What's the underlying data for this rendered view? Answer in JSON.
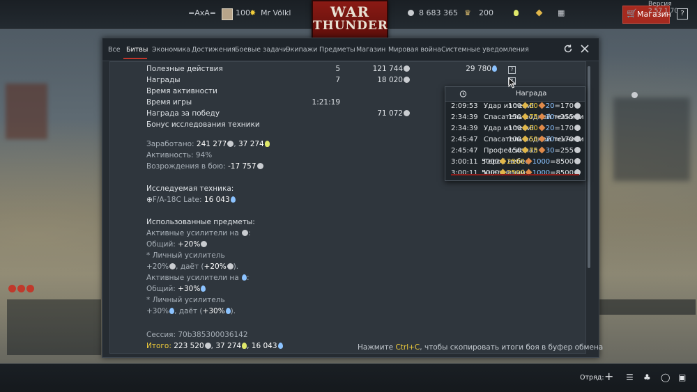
{
  "app": {
    "version": "Версия 2.57.1.70"
  },
  "topbar": {
    "squadron": "=AxA=",
    "level": "100",
    "player": "Mr Völkl",
    "logo_line1": "WAR",
    "logo_line2": "THUNDER",
    "silver_lions": "8 683 365",
    "golden_eagles": "200",
    "shop_label": "Магазин",
    "help_label": "?"
  },
  "tabs": [
    "Все",
    "Битвы",
    "Экономика",
    "Достижения",
    "Боевые задачи",
    "Экипажи",
    "Предметы",
    "Магазин",
    "Мировая война",
    "Системные уведомления"
  ],
  "report": {
    "rows": [
      {
        "label": "Полезные действия",
        "count": "5",
        "sl": "121 744",
        "rp": "29 780"
      },
      {
        "label": "Награды",
        "count": "7",
        "sl": "18 020",
        "rp": ""
      },
      {
        "label": "Время активности",
        "count": "",
        "sl": "",
        "rp": ""
      },
      {
        "label": "Время игры",
        "count": "1:21:19",
        "sl": "",
        "rp": ""
      },
      {
        "label": "Награда за победу",
        "count": "",
        "sl": "71 072",
        "rp": ""
      },
      {
        "label": "Бонус исследования техники",
        "count": "",
        "sl": "",
        "rp": ""
      }
    ],
    "earned_label": "Заработано:",
    "earned_sl": "241 277",
    "earned_bulbs": "37 274",
    "activity": "Активность: 94%",
    "respawn_label": "Возрождения в бою:",
    "respawn_value": "-17 757",
    "researched_label": "Исследуемая техника:",
    "researched_vehicle": "F/A-18C Late:",
    "researched_rp": "16 043",
    "items_label": "Использованные предметы:",
    "boosters_sl_label": "Активные усилители на",
    "general_label": "Общий:",
    "general_sl": "+20%",
    "personal_booster": "* Личный усилитель",
    "personal_sl_a": "+20%",
    "personal_gives": ", даёт (",
    "personal_sl_b": "+20%",
    "personal_end": ").",
    "boosters_rp_label": "Активные усилители на",
    "general_rp": "+30%",
    "personal_rp_a": "+30%",
    "personal_rp_b": "+30%",
    "session": "Сессия: 70b385300036142",
    "total_label": "Итого:",
    "total_sl": "223 520",
    "total_bulbs": "37 274",
    "total_rp": "16 043",
    "footer_a": "Нажмите ",
    "footer_key": "Ctrl+C",
    "footer_b": ", чтобы скопировать итоги боя в буфер обмена"
  },
  "popup": {
    "col_reward": "Награда",
    "rows": [
      {
        "time": "2:09:53",
        "reward": "Удар из тени!",
        "a": "100",
        "b": "50",
        "c": "20",
        "total": "=170"
      },
      {
        "time": "2:34:39",
        "reward": "Спасатель водной техники",
        "a": "150",
        "b": "75",
        "c": "30",
        "total": "=255"
      },
      {
        "time": "2:34:39",
        "reward": "Удар из тени!",
        "a": "100",
        "b": "50",
        "c": "20",
        "total": "=170"
      },
      {
        "time": "2:45:47",
        "reward": "Спасатель водной техники",
        "a": "100",
        "b": "50",
        "c": "20",
        "total": "=170"
      },
      {
        "time": "2:45:47",
        "reward": "Профессионал",
        "a": "150",
        "b": "75",
        "c": "30",
        "total": "=255"
      },
      {
        "time": "3:00:11",
        "reward": "Герой небес",
        "a": "5000",
        "b": "2500",
        "c": "1000",
        "total": "=8500"
      },
      {
        "time": "3:00:11",
        "reward": "Уцелевший",
        "a": "5000",
        "b": "2500",
        "c": "1000",
        "total": "=8500"
      }
    ]
  },
  "bottombar": {
    "squad_label": "Отряд:"
  },
  "colors": {
    "accent": "#c0362b",
    "highlight": "#f0cc3a",
    "research": "#8cc3ff"
  }
}
